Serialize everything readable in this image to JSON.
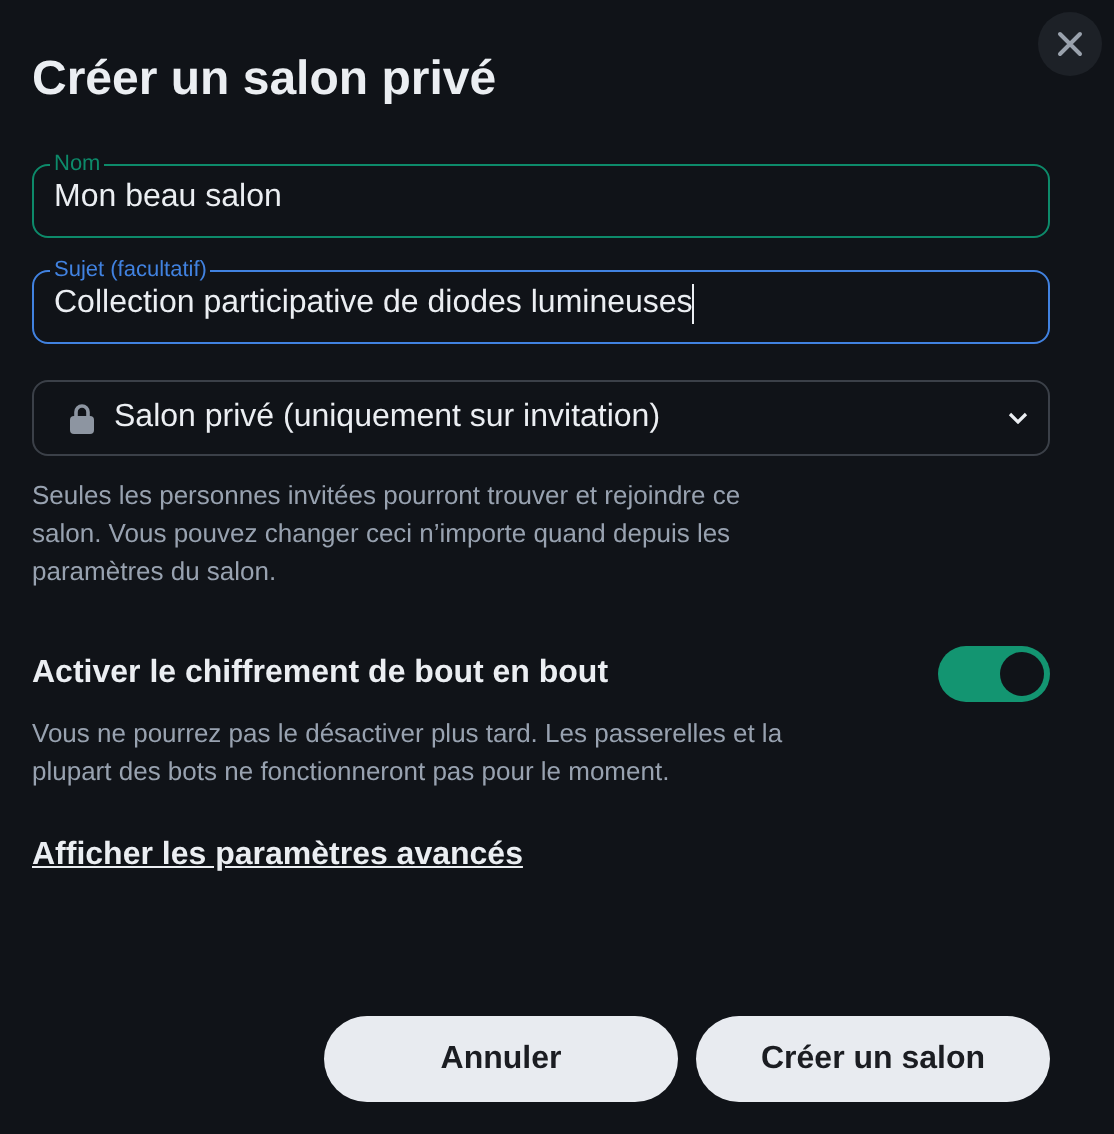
{
  "dialog": {
    "title": "Créer un salon privé"
  },
  "fields": [
    {
      "label": "Nom",
      "value": "Mon beau salon",
      "focused": false
    },
    {
      "label": "Sujet (facultatif)",
      "value": "Collection participative de diodes lumineuses",
      "focused": true
    }
  ],
  "visibility": {
    "value": "Salon privé (uniquement sur invitation)",
    "help": "Seules les personnes invitées pourront trouver et rejoindre ce salon. Vous pouvez changer ceci n’importe quand depuis les paramètres du salon."
  },
  "encryption": {
    "label": "Activer le chiffrement de bout en bout",
    "on": true,
    "description": "Vous ne pourrez pas le désactiver plus tard. Les passerelles et la plupart des bots ne fonctionneront pas pour le moment."
  },
  "advanced_link": "Afficher les paramètres avancés",
  "buttons": [
    "Annuler",
    "Créer un salon"
  ]
}
